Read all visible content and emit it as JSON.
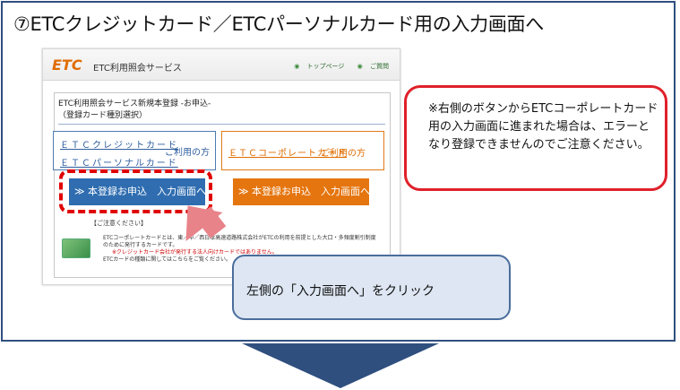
{
  "step_title": "⑦ETCクレジットカード／ETCパーソナルカード用の入力画面へ",
  "shot": {
    "logo_text": "ETC",
    "service_name": "ETC利用照会サービス",
    "links": {
      "top": "トップページ",
      "faq": "ご質問"
    },
    "panel_title_line1": "ETC利用照会サービス新規本登録 -お申込-",
    "panel_title_line2": "（登録カード種別選択）",
    "credit_card": "ＥＴＣクレジットカード",
    "personal_card": "ＥＴＣパーソナルカード",
    "credit_use": "ご利用の方",
    "corporate_card": "ＥＴＣコーポレートカード",
    "corporate_use": "ご利用の方",
    "go_button_left": "≫ 本登録お申込　入力画面へ",
    "go_button_right": "≫ 本登録お申込　入力画面へ",
    "notice_title": "【ご注意ください】",
    "notice_line1": "ETCコーポレートカードとは、東／中／西日本高速道路株式会社がETCの利用を前提とした大口・多頻度割引制度のために発行するカードです。",
    "notice_line2": "※クレジットカード会社が発行する法人向けカードではありません。",
    "notice_line3": "ETCカードの種類に関してはこちらをご覧ください。"
  },
  "callout_bottom": "左側の「入力画面へ」をクリック",
  "callout_warning": "※右側のボタンからETCコーポレートカード用の入力画面に進まれた場合は、エラーとなり登録できませんのでご注意ください。",
  "colors": {
    "frame": "#2f4f7f",
    "warning_border": "#e0202a",
    "bubble_bg": "#dde6f2",
    "pointer": "#e8838a"
  }
}
